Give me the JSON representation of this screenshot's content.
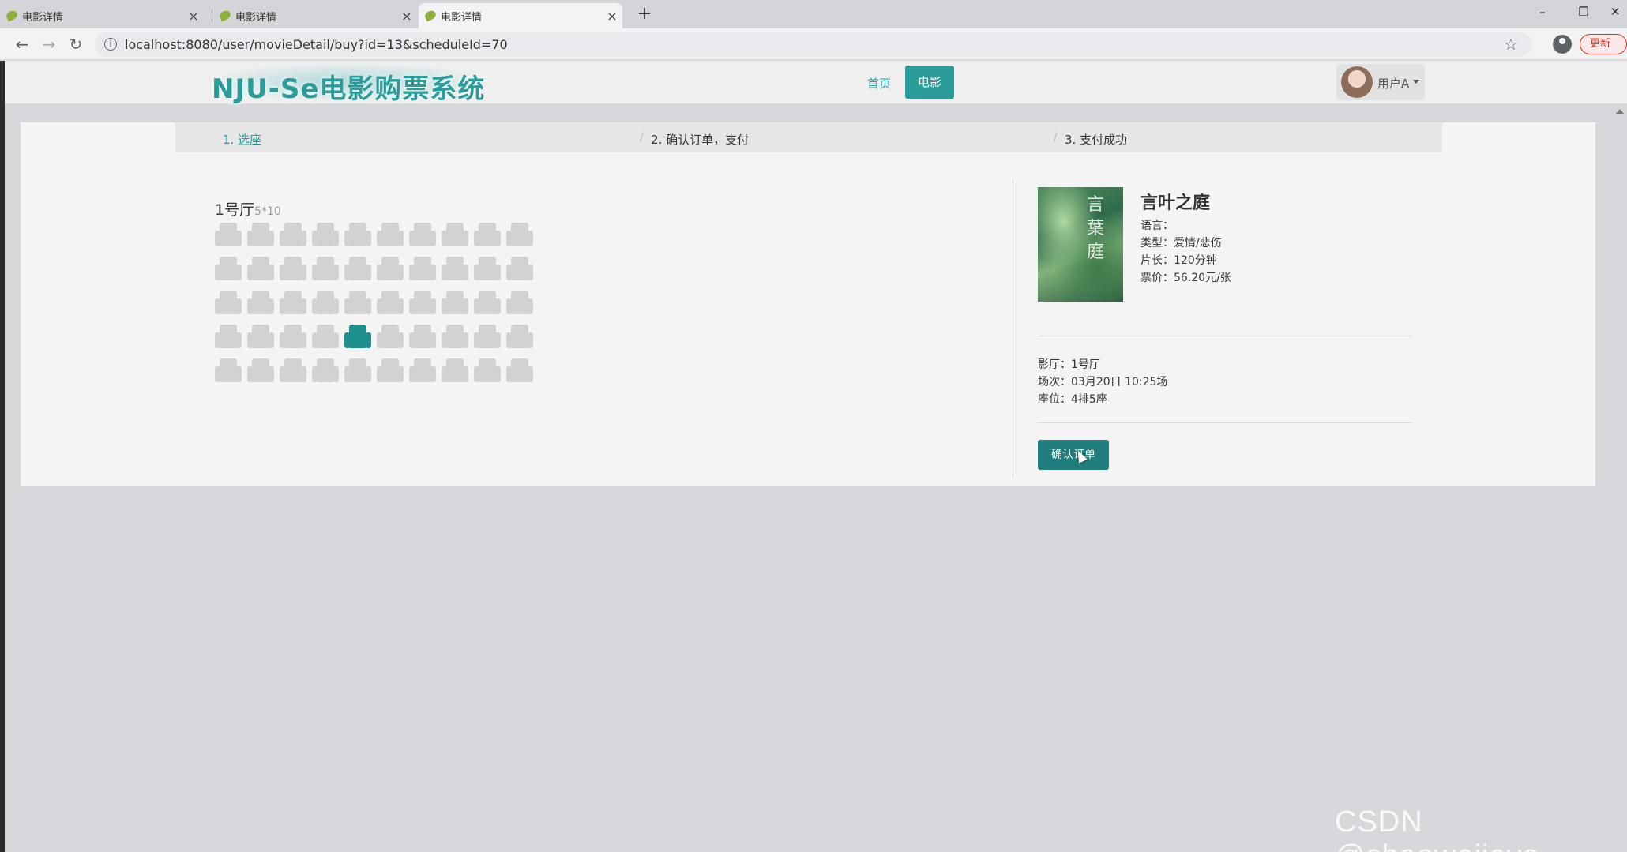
{
  "browser": {
    "tabs": [
      {
        "title": "电影详情",
        "close": "×"
      },
      {
        "title": "电影详情",
        "close": "×"
      },
      {
        "title": "电影详情",
        "close": "×"
      }
    ],
    "new_tab": "+",
    "window_controls": {
      "minimize": "–",
      "restore": "❐",
      "close": "✕"
    },
    "nav": {
      "back": "←",
      "forward": "→",
      "reload": "↻"
    },
    "url": "localhost:8080/user/movieDetail/buy?id=13&scheduleId=70",
    "info_icon": "i",
    "star_icon": "☆",
    "update_label": "更新"
  },
  "header": {
    "logo": "NJU-Se电影购票系统",
    "nav": [
      {
        "label": "首页"
      },
      {
        "label": "电影"
      }
    ],
    "active_nav": "电影",
    "user_name": "用户A"
  },
  "steps": [
    {
      "label": "1. 选座"
    },
    {
      "label": "2. 确认订单，支付"
    },
    {
      "label": "3. 支付成功"
    }
  ],
  "step_separator": "/",
  "hall": {
    "name": "1号厅",
    "size": "5*10",
    "rows": 5,
    "cols": 10,
    "selected": {
      "row": 4,
      "col": 5
    }
  },
  "movie": {
    "poster_text": "言葉庭",
    "name": "言叶之庭",
    "language": "语言：",
    "type": "类型：爱情/悲伤",
    "length": "片长：120分钟",
    "price": "票价：56.20元/张"
  },
  "order": {
    "hall": "影厅：1号厅",
    "schedule": "场次：03月20日 10:25场",
    "seat": "座位：4排5座",
    "confirm_label": "确认订单"
  },
  "colors": {
    "accent": "#2a9d9b",
    "button": "#1f7d7b",
    "selected_seat": "#1f8f8d",
    "seat": "#d2d2d2"
  },
  "watermark": "CSDN @shaoweijava"
}
